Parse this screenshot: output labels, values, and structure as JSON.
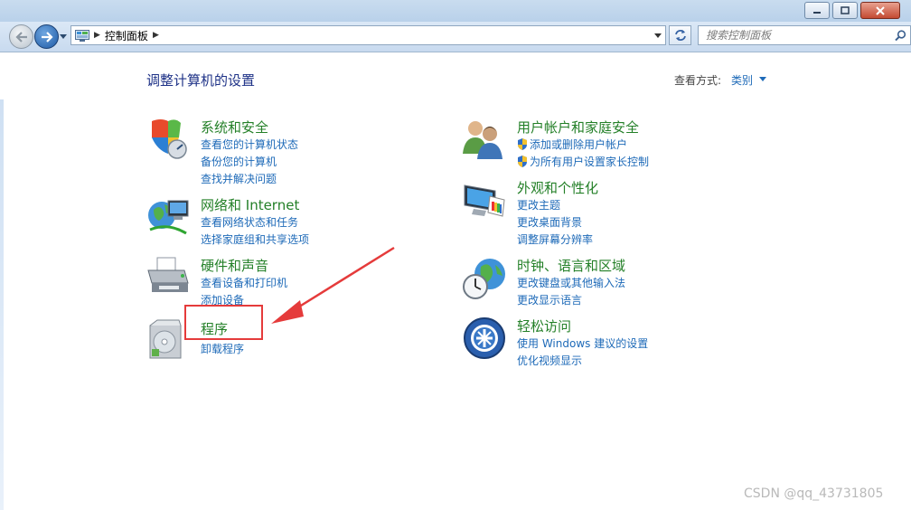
{
  "window": {
    "minimize_glyph": "–",
    "maximize_glyph": "□",
    "close_glyph": "✕"
  },
  "nav": {
    "breadcrumb": "控制面板",
    "search_placeholder": "搜索控制面板"
  },
  "main": {
    "title": "调整计算机的设置",
    "view_by_label": "查看方式:",
    "view_by_value": "类别"
  },
  "categories": [
    {
      "icon": "security-shield-icon",
      "title": "系统和安全",
      "links": [
        "查看您的计算机状态",
        "备份您的计算机",
        "查找并解决问题"
      ]
    },
    {
      "icon": "network-globe-icon",
      "title": "网络和 Internet",
      "links": [
        "查看网络状态和任务",
        "选择家庭组和共享选项"
      ]
    },
    {
      "icon": "printer-icon",
      "title": "硬件和声音",
      "links": [
        "查看设备和打印机",
        "添加设备"
      ]
    },
    {
      "icon": "programs-disc-icon",
      "title": "程序",
      "links": [
        "卸载程序"
      ]
    },
    {
      "icon": "users-icon",
      "title": "用户帐户和家庭安全",
      "links": [
        "添加或删除用户帐户",
        "为所有用户设置家长控制"
      ]
    },
    {
      "icon": "display-paint-icon",
      "title": "外观和个性化",
      "links": [
        "更改主题",
        "更改桌面背景",
        "调整屏幕分辨率"
      ]
    },
    {
      "icon": "clock-globe-icon",
      "title": "时钟、语言和区域",
      "links": [
        "更改键盘或其他输入法",
        "更改显示语言"
      ]
    },
    {
      "icon": "ease-of-access-icon",
      "title": "轻松访问",
      "links": [
        "使用 Windows 建议的设置",
        "优化视频显示"
      ]
    }
  ],
  "annotation": {
    "color": "#e53b3b"
  },
  "watermark": "CSDN @qq_43731805",
  "colors": {
    "title_green": "#248028",
    "link_blue": "#1e6ab8",
    "heading_blue": "#1e3287"
  }
}
